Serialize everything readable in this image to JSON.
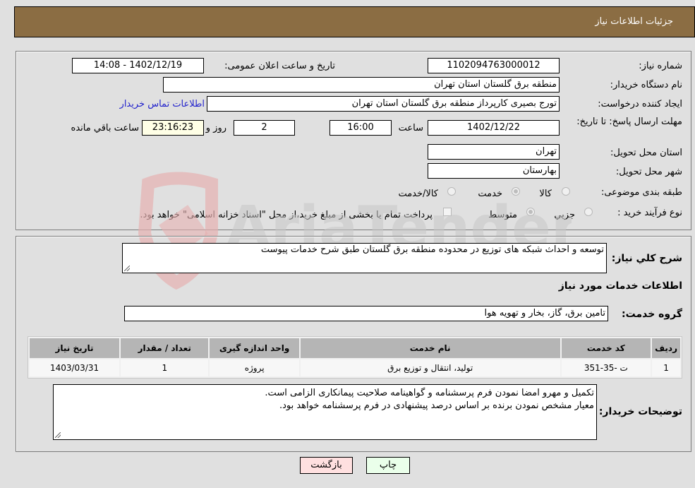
{
  "header": {
    "title": "جزئیات اطلاعات نیاز"
  },
  "form": {
    "need_number": {
      "label": "شماره نیاز:",
      "value": "1102094763000012"
    },
    "announce_datetime": {
      "label": "تاریخ و ساعت اعلان عمومی:",
      "value": "1402/12/19 - 14:08"
    },
    "buyer_org": {
      "label": "نام دستگاه خریدار:",
      "value": "منطقه برق گلستان استان تهران"
    },
    "creator": {
      "label": "ایجاد کننده درخواست:",
      "value": "تورج بصیری کارپرداز منطقه برق گلستان استان تهران"
    },
    "buyer_contact_link": "اطلاعات تماس خریدار",
    "deadline": {
      "label": "مهلت ارسال پاسخ: تا تاریخ:",
      "date": "1402/12/22",
      "time_label": "ساعت",
      "time": "16:00",
      "days": "2",
      "days_label": "روز و",
      "remaining": "23:16:23",
      "remaining_label": "ساعت باقي مانده"
    },
    "province": {
      "label": "استان محل تحویل:",
      "value": "تهران"
    },
    "city": {
      "label": "شهر محل تحویل:",
      "value": "بهارستان"
    },
    "category": {
      "label": "طبقه بندی موضوعی:",
      "options": [
        "کالا",
        "خدمت",
        "کالا/خدمت"
      ],
      "selected": "خدمت"
    },
    "purchase_type": {
      "label": "نوع فرآیند خرید :",
      "options": [
        "جزيي",
        "متوسط"
      ],
      "selected": "متوسط",
      "payment_note": "پرداخت تمام یا بخشی از مبلغ خرید،از محل \"اسناد خزانه اسلامی\" خواهد بود."
    }
  },
  "description": {
    "label": "شرح کلي نياز:",
    "value": "توسعه و احداث شبکه های توزیع در محدوده منطقه برق گلستان طبق شرح خدمات پیوست"
  },
  "services": {
    "section_title": "اطلاعات خدمات مورد نیاز",
    "group_label": "گروه خدمت:",
    "group_value": "تامین برق، گاز، بخار و تهویه هوا",
    "columns": [
      "ردیف",
      "کد خدمت",
      "نام خدمت",
      "واحد اندازه گیری",
      "تعداد / مقدار",
      "تاریخ نیاز"
    ],
    "rows": [
      [
        "1",
        "ت -35-351",
        "تولید، انتقال و توزیع برق",
        "پروژه",
        "1",
        "1403/03/31"
      ]
    ]
  },
  "buyer_notes": {
    "label": "توضیحات خریدار:",
    "lines": [
      "تکمیل و مهرو امضا نمودن فرم پرسشنامه و گواهینامه صلاحیت پیمانکاری الزامی است.",
      "معیار مشخص نمودن برنده بر اساس درصد پیشنهادی در فرم پرسشنامه خواهد بود."
    ]
  },
  "buttons": {
    "print": "چاپ",
    "back": "بازگشت"
  },
  "watermark": "AriaTender.neT"
}
